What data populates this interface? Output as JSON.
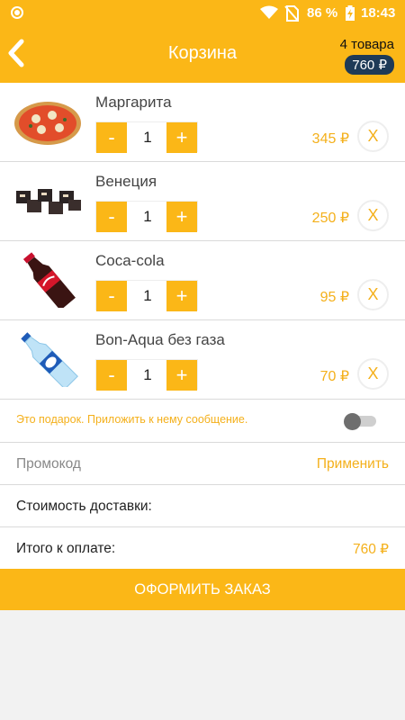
{
  "status_bar": {
    "battery_percent": "86 %",
    "time": "18:43",
    "icons": [
      "app-notification-icon",
      "wifi-icon",
      "no-sim-icon",
      "battery-charging-icon"
    ]
  },
  "header": {
    "back_icon": "chevron-left-icon",
    "title": "Корзина",
    "items_count": "4 товара",
    "total": "760 ₽"
  },
  "cart": {
    "items": [
      {
        "name": "Маргарита",
        "qty": "1",
        "price": "345 ₽",
        "minus": "-",
        "plus": "+",
        "remove": "X",
        "image": "pizza"
      },
      {
        "name": "Венеция",
        "qty": "1",
        "price": "250 ₽",
        "minus": "-",
        "plus": "+",
        "remove": "X",
        "image": "dark-rolls"
      },
      {
        "name": "Coca-cola",
        "qty": "1",
        "price": "95 ₽",
        "minus": "-",
        "plus": "+",
        "remove": "X",
        "image": "cola-bottle"
      },
      {
        "name": "Bon-Aqua без газа",
        "qty": "1",
        "price": "70 ₽",
        "minus": "-",
        "plus": "+",
        "remove": "X",
        "image": "water-bottle"
      }
    ]
  },
  "gift": {
    "label": "Это подарок. Приложить к нему сообщение.",
    "toggle_on": false
  },
  "promo": {
    "placeholder": "Промокод",
    "apply": "Применить"
  },
  "delivery": {
    "label": "Стоимость доставки:"
  },
  "total": {
    "label": "Итого к оплате:",
    "value": "760 ₽"
  },
  "checkout": {
    "label": "ОФОРМИТЬ ЗАКАЗ"
  },
  "colors": {
    "accent": "#fbb717",
    "price": "#f4b01b",
    "pill": "#1e3a57"
  }
}
